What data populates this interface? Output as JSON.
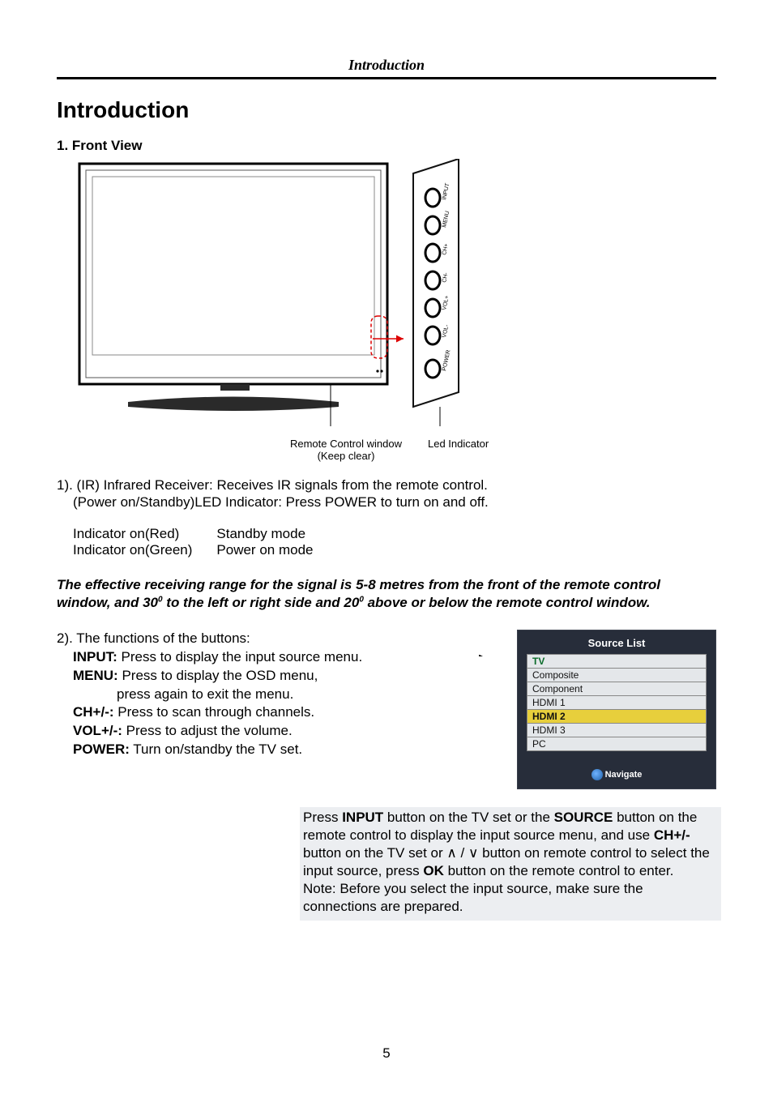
{
  "header": {
    "running_title": "Introduction"
  },
  "page_title": "Introduction",
  "section1_heading": "1. Front View",
  "fig": {
    "buttons": [
      "INPUT",
      "MENU",
      "CH+",
      "CH-",
      "VOL+",
      "VOL-",
      "POWER"
    ],
    "caption_left_l1": "Remote Control window",
    "caption_left_l2": "(Keep clear)",
    "caption_right": "Led Indicator"
  },
  "para1_l1": "1). (IR) Infrared Receiver: Receives IR signals from the remote control.",
  "para1_l2": "(Power on/Standby)LED Indicator: Press POWER to turn on and off.",
  "indicator_rows": [
    {
      "left": "Indicator on(Red)",
      "right": "Standby mode"
    },
    {
      "left": "Indicator on(Green)",
      "right": "Power on mode"
    }
  ],
  "range_note": "The effective receiving range for the signal is 5-8 metres from the front of the remote control window, and 30° to the left or right side and 20° above or below the remote control window.",
  "functions_intro": "2). The functions of the buttons:",
  "functions": [
    {
      "name": "INPUT:",
      "desc": " Press to display the input source menu."
    },
    {
      "name": "MENU:",
      "desc": " Press to display the OSD menu,"
    },
    {
      "cont": "press again to exit the menu."
    },
    {
      "name": "CH+/-:",
      "desc": " Press to scan through channels."
    },
    {
      "name": "VOL+/-:",
      "desc": " Press to adjust the volume."
    },
    {
      "name": "POWER:",
      "desc": " Turn on/standby the TV set."
    }
  ],
  "source_list": {
    "title": "Source List",
    "items": [
      "TV",
      "Composite",
      "Component",
      "HDMI 1",
      "HDMI 2",
      "HDMI 3",
      "PC"
    ],
    "selected_index": 4,
    "nav_label": "Navigate"
  },
  "bottom_note": {
    "p1a": "Press ",
    "p1b": "INPUT",
    "p1c": " button on the TV set or the ",
    "p1d": "SOURCE",
    "p1e": " button on the remote control to display the input source menu, and use ",
    "p1f": "CH+/-",
    "p1g": " button on the TV set or ",
    "p1h": " button on remote control to select the input source, press ",
    "p1i": "OK",
    "p1j": " button on the remote control to enter.",
    "p2": "Note: Before you select the input source, make sure the connections are prepared."
  },
  "page_number": "5"
}
